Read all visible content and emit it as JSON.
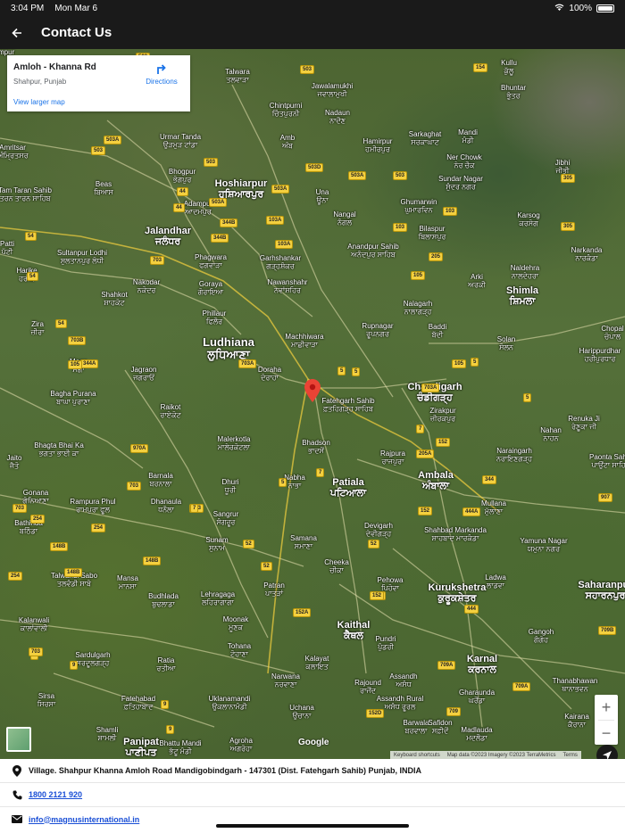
{
  "status_bar": {
    "time": "3:04 PM",
    "date": "Mon Mar 6",
    "battery": "100%"
  },
  "app_bar": {
    "title": "Contact Us"
  },
  "map": {
    "info_card": {
      "title": "Amloh - Khanna Rd",
      "subtitle": "Shahpur, Punjab",
      "directions_label": "Directions",
      "view_larger_label": "View larger map"
    },
    "google_label": "Google",
    "attribution": {
      "shortcuts": "Keyboard shortcuts",
      "map_data": "Map data ©2023 Imagery ©2023 TerraMetrics",
      "terms": "Terms"
    },
    "zoom_in_label": "+",
    "zoom_out_label": "−",
    "places": [
      {
        "name": "Amritsar",
        "local": "ਅੰਮ੍ਰਿਤਸਰ",
        "size": "normal"
      },
      {
        "name": "Tam Taran Sahib",
        "local": "ਤਰਨ ਤਾਰਨ ਸਾਹਿਬ",
        "size": "small"
      },
      {
        "name": "Beas",
        "local": "ਬਿਆਸ",
        "size": "small"
      },
      {
        "name": "Urmar Tanda",
        "local": "ਉੜਮੁੜ ਟਾਂਡਾ",
        "size": "small"
      },
      {
        "name": "Talwara",
        "local": "ਤਲਵਾੜਾ",
        "size": "small"
      },
      {
        "name": "Chintpurni",
        "local": "ਚਿੰਤਪੁਰਨੀ",
        "size": "small"
      },
      {
        "name": "Jawalamukhi",
        "local": "ਜਵਾਲਾਮੁਖੀ",
        "size": "small"
      },
      {
        "name": "Kullu",
        "local": "ਕੁੱਲੂ",
        "size": "small"
      },
      {
        "name": "Bhuntar",
        "local": "ਭੁੰਤਰ",
        "size": "small"
      },
      {
        "name": "Nadaun",
        "local": "ਨਾਦੌਣ",
        "size": "small"
      },
      {
        "name": "Sarkaghat",
        "local": "ਸਰਕਾਘਾਟ",
        "size": "small"
      },
      {
        "name": "Mandi",
        "local": "ਮੰਡੀ",
        "size": "small"
      },
      {
        "name": "Amb",
        "local": "ਅੰਬ",
        "size": "small"
      },
      {
        "name": "Hamirpur",
        "local": "ਹਮੀਰਪੁਰ",
        "size": "small"
      },
      {
        "name": "Ner Chowk",
        "local": "ਨੇਰ ਚੌਕ",
        "size": "small"
      },
      {
        "name": "Jibhi",
        "local": "ਜੀਭੀ",
        "size": "small"
      },
      {
        "name": "Bhogpur",
        "local": "ਭੋਗਪੁਰ",
        "size": "small"
      },
      {
        "name": "Hoshiarpur",
        "local": "ਹੁਸ਼ਿਆਰਪੁਰ",
        "size": "city"
      },
      {
        "name": "Una",
        "local": "ਊਨਾ",
        "size": "small"
      },
      {
        "name": "Sundar Nagar",
        "local": "ਸੁੰਦਰ ਨਗਰ",
        "size": "small"
      },
      {
        "name": "Adampur",
        "local": "ਆਦਮਪੁਰ",
        "size": "small"
      },
      {
        "name": "Ghumarwin",
        "local": "ਘੁਮਾਰਵਿਨ",
        "size": "small"
      },
      {
        "name": "Nangal",
        "local": "ਨੰਗਲ",
        "size": "small"
      },
      {
        "name": "Karsog",
        "local": "ਕਰਸੋਗ",
        "size": "small"
      },
      {
        "name": "Jalandhar",
        "local": "ਜਲੰਧਰ",
        "size": "city"
      },
      {
        "name": "Bilaspur",
        "local": "ਬਿਲਾਸਪੁਰ",
        "size": "small"
      },
      {
        "name": "Patti",
        "local": "ਪੱਟੀ",
        "size": "small"
      },
      {
        "name": "Sultanpur Lodhi",
        "local": "ਸੁਲਤਾਨਪੁਰ ਲੋਧੀ",
        "size": "small"
      },
      {
        "name": "Phagwara",
        "local": "ਫਗਵਾੜਾ",
        "size": "small"
      },
      {
        "name": "Garhshankar",
        "local": "ਗੜ੍ਹਸ਼ੰਕਰ",
        "size": "small"
      },
      {
        "name": "Anandpur Sahib",
        "local": "ਅਨੰਦਪੁਰ ਸਾਹਿਬ",
        "size": "small"
      },
      {
        "name": "Narkanda",
        "local": "ਨਾਰਕੰਡਾ",
        "size": "small"
      },
      {
        "name": "Harike",
        "local": "ਹਰੀਕੇ",
        "size": "small"
      },
      {
        "name": "Nakodar",
        "local": "ਨਕੋਦਰ",
        "size": "small"
      },
      {
        "name": "Goraya",
        "local": "ਗੋਰਾਇਆ",
        "size": "small"
      },
      {
        "name": "Nawanshahr",
        "local": "ਨਵਾਂਸ਼ਹਿਰ",
        "size": "small"
      },
      {
        "name": "Arki",
        "local": "ਅਰਕੀ",
        "size": "small"
      },
      {
        "name": "Naldehra",
        "local": "ਨਾਲਦੇਹਰਾ",
        "size": "small"
      },
      {
        "name": "Shahkot",
        "local": "ਸ਼ਾਹਕੋਟ",
        "size": "small"
      },
      {
        "name": "Nalagarh",
        "local": "ਨਾਲਾਗੜ੍ਹ",
        "size": "small"
      },
      {
        "name": "Shimla",
        "local": "ਸ਼ਿਮਲਾ",
        "size": "city"
      },
      {
        "name": "Phillaur",
        "local": "ਫਿਲੌਰ",
        "size": "small"
      },
      {
        "name": "Zira",
        "local": "ਜ਼ੀਰਾ",
        "size": "small"
      },
      {
        "name": "Machhiwara",
        "local": "ਮਾਛੀਵਾੜਾ",
        "size": "small"
      },
      {
        "name": "Rupnagar",
        "local": "ਰੂਪਨਗਰ",
        "size": "small"
      },
      {
        "name": "Baddi",
        "local": "ਬੱਦੀ",
        "size": "small"
      },
      {
        "name": "Solan",
        "local": "ਸੋਲਨ",
        "size": "small"
      },
      {
        "name": "Chopal",
        "local": "ਚੋਪਾਲ",
        "size": "small"
      },
      {
        "name": "Ludhiana",
        "local": "ਲੁਧਿਆਣਾ",
        "size": "big"
      },
      {
        "name": "Moga",
        "local": "ਮੋਗਾ",
        "size": "small"
      },
      {
        "name": "Jagraon",
        "local": "ਜਗਰਾਓਂ",
        "size": "small"
      },
      {
        "name": "Doraha",
        "local": "ਦੋਰਾਹਾ",
        "size": "small"
      },
      {
        "name": "Chandigarh",
        "local": "ਚੰਡੀਗੜ੍ਹ",
        "size": "city"
      },
      {
        "name": "Fatehgarh Sahib",
        "local": "ਫ਼ਤਹਿਗੜ੍ਹ ਸਾਹਿਬ",
        "size": "small"
      },
      {
        "name": "Bagha Purana",
        "local": "ਬਾਘਾ ਪੁਰਾਣਾ",
        "size": "small"
      },
      {
        "name": "Raikot",
        "local": "ਰਾਏਕੋਟ",
        "size": "small"
      },
      {
        "name": "Zirakpur",
        "local": "ਜ਼ੀਰਕਪੁਰ",
        "size": "small"
      },
      {
        "name": "Harippurdhar",
        "local": "ਹਰੀਪੁਰਧਾਰ",
        "size": "small"
      },
      {
        "name": "Renuka Ji",
        "local": "ਰੇਣੂਕਾ ਜੀ",
        "size": "small"
      },
      {
        "name": "Nahan",
        "local": "ਨਾਹਨ",
        "size": "small"
      },
      {
        "name": "Malerkotla",
        "local": "ਮਾਲੇਰਕੋਟਲਾ",
        "size": "small"
      },
      {
        "name": "Bhadson",
        "local": "ਭਾਦਸੋਂ",
        "size": "small"
      },
      {
        "name": "Rajpura",
        "local": "ਰਾਜਪੁਰਾ",
        "size": "small"
      },
      {
        "name": "Naraingarh",
        "local": "ਨਰਾਇਣਗੜ੍ਹ",
        "size": "small"
      },
      {
        "name": "Paonta Sahib",
        "local": "ਪਾਉਂਟਾ ਸਾਹਿਬ",
        "size": "small"
      },
      {
        "name": "Bhagta Bhai Ka",
        "local": "ਭਗਤਾ ਭਾਈ ਕਾ",
        "size": "small"
      },
      {
        "name": "Jaito",
        "local": "ਜੈਤੋ",
        "size": "small"
      },
      {
        "name": "Dhuri",
        "local": "ਧੂਰੀ",
        "size": "small"
      },
      {
        "name": "Barnala",
        "local": "ਬਰਨਾਲਾ",
        "size": "small"
      },
      {
        "name": "Nabha",
        "local": "ਨਾਭਾ",
        "size": "small"
      },
      {
        "name": "Patiala",
        "local": "ਪਟਿਆਲਾ",
        "size": "city"
      },
      {
        "name": "Ambala",
        "local": "ਅੰਬਾਲਾ",
        "size": "city"
      },
      {
        "name": "Gonana",
        "local": "ਗੋਨਿਆਣਾ",
        "size": "small"
      },
      {
        "name": "Rampura Phul",
        "local": "ਰਾਮਪੁਰਾ ਫੂਲ",
        "size": "small"
      },
      {
        "name": "Dhanaula",
        "local": "ਧਨੌਲਾ",
        "size": "small"
      },
      {
        "name": "Mullana",
        "local": "ਮੁੱਲਾਣਾ",
        "size": "small"
      },
      {
        "name": "Bathinda",
        "local": "ਬਠਿੰਡਾ",
        "size": "small"
      },
      {
        "name": "Sangrur",
        "local": "ਸੰਗਰੂਰ",
        "size": "small"
      },
      {
        "name": "Devigarh",
        "local": "ਦੇਵੀਗੜ੍ਹ",
        "size": "small"
      },
      {
        "name": "Shahbad Markanda",
        "local": "ਸ਼ਾਹਬਾਦ ਮਾਰਕੰਡਾ",
        "size": "small"
      },
      {
        "name": "Yamuna Nagar",
        "local": "ਯਮੁਨਾ ਨਗਰ",
        "size": "small"
      },
      {
        "name": "Sunam",
        "local": "ਸੁਨਾਮ",
        "size": "small"
      },
      {
        "name": "Samana",
        "local": "ਸਮਾਣਾ",
        "size": "small"
      },
      {
        "name": "Cheeka",
        "local": "ਚੀਕਾ",
        "size": "small"
      },
      {
        "name": "Talwandi Sabo",
        "local": "ਤਲਵੰਡੀ ਸਾਬੋ",
        "size": "small"
      },
      {
        "name": "Mansa",
        "local": "ਮਾਨਸਾ",
        "size": "small"
      },
      {
        "name": "Pehowa",
        "local": "ਪਿਹੋਵਾ",
        "size": "small"
      },
      {
        "name": "Kurukshetra",
        "local": "ਕੁਰੂਕਸ਼ੇਤਰ",
        "size": "city"
      },
      {
        "name": "Ladwa",
        "local": "ਲਾਡਵਾ",
        "size": "small"
      },
      {
        "name": "Saharanpur",
        "local": "ਸਹਾਰਨਪੁਰ",
        "size": "city"
      },
      {
        "name": "Budhlada",
        "local": "ਬੁਢਲਾਡਾ",
        "size": "small"
      },
      {
        "name": "Lehragaga",
        "local": "ਲਹਿਰਾਗਾਗਾ",
        "size": "small"
      },
      {
        "name": "Patran",
        "local": "ਪਾਤੜਾਂ",
        "size": "small"
      },
      {
        "name": "Kalanwali",
        "local": "ਕਾਲਾਂਵਾਲੀ",
        "size": "small"
      },
      {
        "name": "Moonak",
        "local": "ਮੂਣਕ",
        "size": "small"
      },
      {
        "name": "Kaithal",
        "local": "ਕੈਥਲ",
        "size": "city"
      },
      {
        "name": "Pundri",
        "local": "ਪੁੰਡਰੀ",
        "size": "small"
      },
      {
        "name": "Gangoh",
        "local": "ਗੰਗੋਹ",
        "size": "small"
      },
      {
        "name": "Sardulgarh",
        "local": "ਸਰਦੂਲਗੜ੍ਹ",
        "size": "small"
      },
      {
        "name": "Tohana",
        "local": "ਟੋਹਾਣਾ",
        "size": "small"
      },
      {
        "name": "Ratia",
        "local": "ਰਤੀਆ",
        "size": "small"
      },
      {
        "name": "Kalayat",
        "local": "ਕਲਾਇਤ",
        "size": "small"
      },
      {
        "name": "Karnal",
        "local": "ਕਰਨਾਲ",
        "size": "city"
      },
      {
        "name": "Narwana",
        "local": "ਨਰਵਾਣਾ",
        "size": "small"
      },
      {
        "name": "Assandh",
        "local": "ਅਸੰਧ",
        "size": "small"
      },
      {
        "name": "Rajound",
        "local": "ਰਾਜੌਂਦ",
        "size": "small"
      },
      {
        "name": "Gharaunda",
        "local": "ਘਰੌਂਡਾ",
        "size": "small"
      },
      {
        "name": "Thanabhawan",
        "local": "ਥਾਨਾਭਵਨ",
        "size": "small"
      },
      {
        "name": "Sirsa",
        "local": "ਸਿਰਸਾ",
        "size": "small"
      },
      {
        "name": "Fatehabad",
        "local": "ਫ਼ਤਿਹਾਬਾਦ",
        "size": "small"
      },
      {
        "name": "Uklanamandi",
        "local": "ਉਕਲਾਨਾਮੰਡੀ",
        "size": "small"
      },
      {
        "name": "Uchana",
        "local": "ਉਚਾਨਾ",
        "size": "small"
      },
      {
        "name": "Assandh Rural",
        "local": "ਅਸੰਧ ਰੂਰਲ",
        "size": "small"
      },
      {
        "name": "Kairana",
        "local": "ਕੈਰਾਨਾ",
        "size": "small"
      },
      {
        "name": "Shamli",
        "local": "ਸ਼ਾਮਲੀ",
        "size": "small"
      },
      {
        "name": "Bhattu Mandi",
        "local": "ਭੱਟੂ ਮੰਡੀ",
        "size": "small"
      },
      {
        "name": "Agroha",
        "local": "ਅਗਰੋਹਾ",
        "size": "small"
      },
      {
        "name": "Barwala",
        "local": "ਬਰਵਾਲਾ",
        "size": "small"
      },
      {
        "name": "Safidon",
        "local": "ਸਫ਼ੀਦੋਂ",
        "size": "small"
      },
      {
        "name": "Madlauda",
        "local": "ਮਦਲੌਡਾ",
        "size": "small"
      },
      {
        "name": "Panipat",
        "local": "ਪਾਣੀਪਤ",
        "size": "city"
      },
      {
        "name": "Adampur",
        "local": "",
        "size": "small"
      }
    ],
    "shields": [
      "503",
      "154",
      "503",
      "503A",
      "503",
      "503",
      "503D",
      "503A",
      "44",
      "503A",
      "503",
      "503A",
      "103",
      "305",
      "44",
      "344B",
      "103A",
      "103",
      "305",
      "54",
      "344B",
      "103A",
      "205",
      "54",
      "703",
      "105",
      "54",
      "703A",
      "5",
      "105",
      "5",
      "703B",
      "344A",
      "5",
      "105",
      "5",
      "703A",
      "5",
      "970A",
      "703",
      "7",
      "152",
      "205A",
      "703",
      "703",
      "7",
      "254",
      "254",
      "7",
      "148B",
      "52",
      "148B",
      "52",
      "152",
      "344",
      "152",
      "444A",
      "907",
      "52",
      "254",
      "148B",
      "152A",
      "152",
      "444",
      "709B",
      "9",
      "9",
      "703",
      "709A",
      "709A",
      "9",
      "152D",
      "709",
      "9"
    ]
  },
  "contact": {
    "address": "Village. Shahpur Khanna Amloh Road Mandigobindgarh - 147301 (Dist. Fatehgarh Sahib) Punjab, INDIA",
    "phone": "1800 2121 920",
    "email": "info@magnusinternational.in"
  }
}
